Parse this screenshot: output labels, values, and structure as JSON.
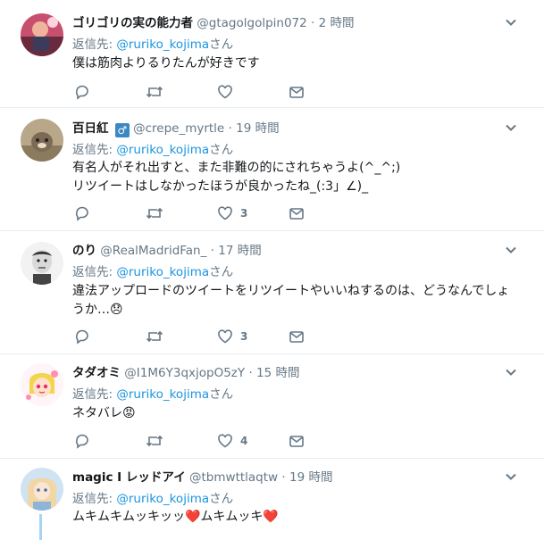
{
  "reply_prefix": "返信先: ",
  "reply_suffix": "さん",
  "colors": {
    "link": "#1b95e0",
    "muted": "#657786",
    "border": "#e6ecf0",
    "thread": "#a5d4f5"
  },
  "icons": {
    "reply": "reply-icon",
    "retweet": "retweet-icon",
    "like": "heart-icon",
    "dm": "envelope-icon",
    "menu": "chevron-down-icon"
  },
  "tweets": [
    {
      "name": "ゴリゴリの実の能力者",
      "handle": "@gtagolgolpin072",
      "dot": "·",
      "time": "2 時間",
      "reply_to": "@ruriko_kojima",
      "lines": [
        "僕は筋肉よりるりたんが好きです"
      ],
      "like_count": ""
    },
    {
      "name": "百日紅",
      "gender_badge": "♂",
      "handle": "@crepe_myrtle",
      "dot": "·",
      "time": "19 時間",
      "reply_to": "@ruriko_kojima",
      "lines": [
        "有名人がそれ出すと、また非難の的にされちゃうよ(^_^;)",
        "リツイートはしなかったほうが良かったね_(:3」∠)_"
      ],
      "like_count": "3"
    },
    {
      "name": "のり",
      "handle": "@RealMadridFan_",
      "dot": "·",
      "time": "17 時間",
      "reply_to": "@ruriko_kojima",
      "lines": [
        "違法アップロードのツイートをリツイートやいいねするのは、どうなんでしょ",
        "うか…😞"
      ],
      "like_count": "3"
    },
    {
      "name": "タダオミ",
      "handle": "@I1M6Y3qxjopO5zY",
      "dot": "·",
      "time": "15 時間",
      "reply_to": "@ruriko_kojima",
      "lines": [
        "ネタバレ😡"
      ],
      "like_count": "4"
    },
    {
      "name": "magic I レッドアイ",
      "handle": "@tbmwttlaqtw",
      "dot": "·",
      "time": "19 時間",
      "reply_to": "@ruriko_kojima",
      "lines": [
        "ムキムキムッキッッ❤️ムキムッキ❤️"
      ],
      "like_count": ""
    }
  ]
}
